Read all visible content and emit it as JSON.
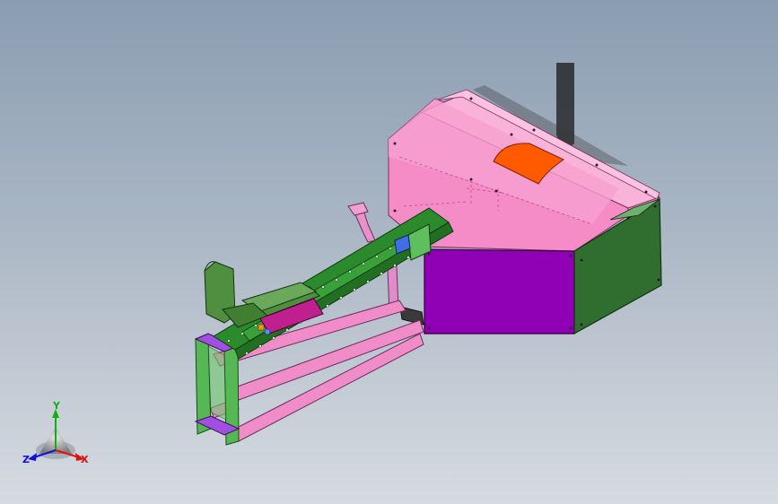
{
  "app": {
    "title": ""
  },
  "viewport": {
    "background_top": "#8a9db2",
    "background_bottom": "#d6dbe1"
  },
  "model": {
    "colors": {
      "housing_pink": "#f58cc8",
      "housing_top": "#f9b2d8",
      "housing_light": "#fbc2e1",
      "front_panel_purple": "#9000b4",
      "side_panel_green": "#2f6e2f",
      "cover_orange": "#ff5a00",
      "rail_green": "#2b8a2b",
      "frame_pink": "#f08cc8",
      "frame_green": "#55b855",
      "bracket_violet": "#a050e0",
      "guard_green": "#4f8f3f",
      "slider_magenta": "#c0208f",
      "shadow": "#1a1a1a"
    }
  },
  "triad": {
    "x_label": "X",
    "y_label": "Y",
    "z_label": "Z",
    "x_color": "#e01010",
    "y_color": "#10b010",
    "z_color": "#1010e0"
  }
}
